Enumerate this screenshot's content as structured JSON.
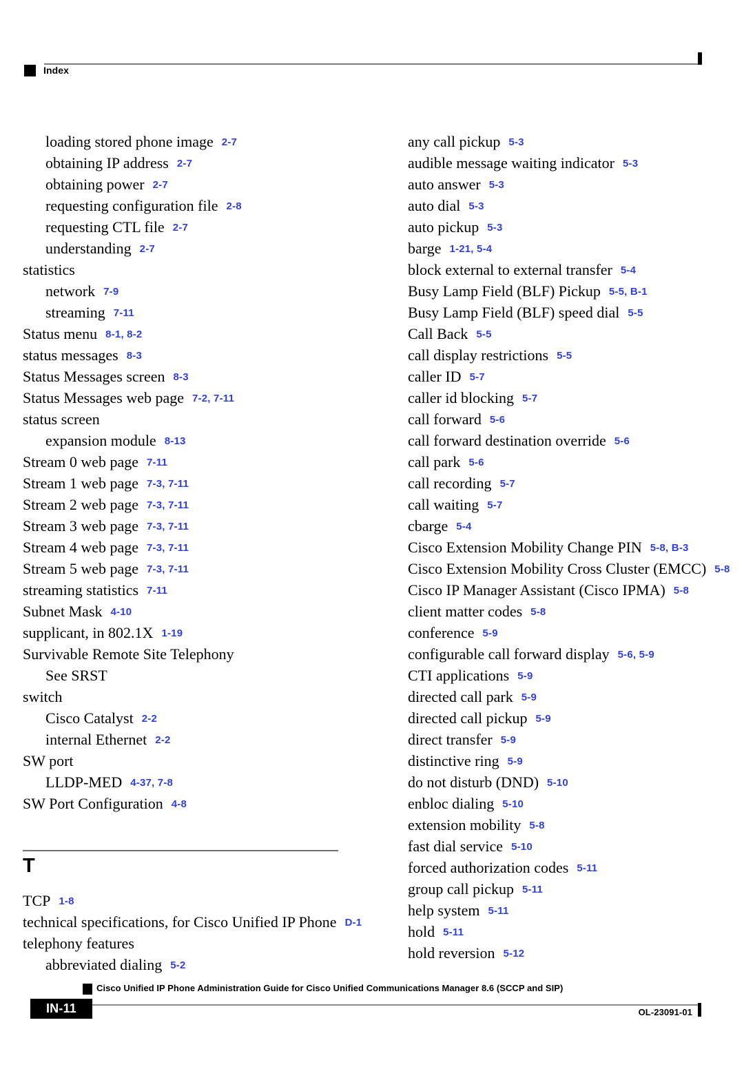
{
  "header": {
    "title": "Index",
    "marker_icon": "black-square-icon"
  },
  "columns": {
    "left": [
      {
        "kind": "entry",
        "level": 1,
        "term": "loading stored phone image",
        "refs": "2-7"
      },
      {
        "kind": "entry",
        "level": 1,
        "term": "obtaining IP address",
        "refs": "2-7"
      },
      {
        "kind": "entry",
        "level": 1,
        "term": "obtaining power",
        "refs": "2-7"
      },
      {
        "kind": "entry",
        "level": 1,
        "term": "requesting configuration file",
        "refs": "2-8"
      },
      {
        "kind": "entry",
        "level": 1,
        "term": "requesting CTL file",
        "refs": "2-7"
      },
      {
        "kind": "entry",
        "level": 1,
        "term": "understanding",
        "refs": "2-7"
      },
      {
        "kind": "entry",
        "level": 0,
        "term": "statistics",
        "refs": ""
      },
      {
        "kind": "entry",
        "level": 1,
        "term": "network",
        "refs": "7-9"
      },
      {
        "kind": "entry",
        "level": 1,
        "term": "streaming",
        "refs": "7-11"
      },
      {
        "kind": "entry",
        "level": 0,
        "term": "Status menu",
        "refs": "8-1, 8-2"
      },
      {
        "kind": "entry",
        "level": 0,
        "term": "status messages",
        "refs": "8-3"
      },
      {
        "kind": "entry",
        "level": 0,
        "term": "Status Messages screen",
        "refs": "8-3"
      },
      {
        "kind": "entry",
        "level": 0,
        "term": "Status Messages web page",
        "refs": "7-2, 7-11"
      },
      {
        "kind": "entry",
        "level": 0,
        "term": "status screen",
        "refs": ""
      },
      {
        "kind": "entry",
        "level": 1,
        "term": "expansion module",
        "refs": "8-13"
      },
      {
        "kind": "entry",
        "level": 0,
        "term": "Stream 0 web page",
        "refs": "7-11"
      },
      {
        "kind": "entry",
        "level": 0,
        "term": "Stream 1 web page",
        "refs": "7-3, 7-11"
      },
      {
        "kind": "entry",
        "level": 0,
        "term": "Stream 2 web page",
        "refs": "7-3, 7-11"
      },
      {
        "kind": "entry",
        "level": 0,
        "term": "Stream 3 web page",
        "refs": "7-3, 7-11"
      },
      {
        "kind": "entry",
        "level": 0,
        "term": "Stream 4 web page",
        "refs": "7-3, 7-11"
      },
      {
        "kind": "entry",
        "level": 0,
        "term": "Stream 5 web page",
        "refs": "7-3, 7-11"
      },
      {
        "kind": "entry",
        "level": 0,
        "term": "streaming statistics",
        "refs": "7-11"
      },
      {
        "kind": "entry",
        "level": 0,
        "term": "Subnet Mask",
        "refs": "4-10"
      },
      {
        "kind": "entry",
        "level": 0,
        "term": "supplicant, in 802.1X",
        "refs": "1-19"
      },
      {
        "kind": "entry",
        "level": 0,
        "term": "Survivable Remote Site Telephony",
        "refs": ""
      },
      {
        "kind": "entry",
        "level": 1,
        "term": "See SRST",
        "refs": ""
      },
      {
        "kind": "entry",
        "level": 0,
        "term": "switch",
        "refs": ""
      },
      {
        "kind": "entry",
        "level": 1,
        "term": "Cisco Catalyst",
        "refs": "2-2"
      },
      {
        "kind": "entry",
        "level": 1,
        "term": "internal Ethernet",
        "refs": "2-2"
      },
      {
        "kind": "entry",
        "level": 0,
        "term": "SW port",
        "refs": ""
      },
      {
        "kind": "entry",
        "level": 1,
        "term": "LLDP-MED",
        "refs": "4-37, 7-8"
      },
      {
        "kind": "entry",
        "level": 0,
        "term": "SW Port Configuration",
        "refs": "4-8"
      },
      {
        "kind": "section",
        "letter": "T"
      },
      {
        "kind": "entry",
        "level": 0,
        "term": "TCP",
        "refs": "1-8"
      },
      {
        "kind": "entry",
        "level": 0,
        "term": "technical specifications, for Cisco Unified IP Phone",
        "refs": "D-1"
      },
      {
        "kind": "entry",
        "level": 0,
        "term": "telephony features",
        "refs": ""
      },
      {
        "kind": "entry",
        "level": 1,
        "term": "abbreviated dialing",
        "refs": "5-2"
      }
    ],
    "right": [
      {
        "kind": "entry",
        "level": 0,
        "term": "any call pickup",
        "refs": "5-3"
      },
      {
        "kind": "entry",
        "level": 0,
        "term": "audible message waiting indicator",
        "refs": "5-3"
      },
      {
        "kind": "entry",
        "level": 0,
        "term": "auto answer",
        "refs": "5-3"
      },
      {
        "kind": "entry",
        "level": 0,
        "term": "auto dial",
        "refs": "5-3"
      },
      {
        "kind": "entry",
        "level": 0,
        "term": "auto pickup",
        "refs": "5-3"
      },
      {
        "kind": "entry",
        "level": 0,
        "term": "barge",
        "refs": "1-21, 5-4"
      },
      {
        "kind": "entry",
        "level": 0,
        "term": "block external to external transfer",
        "refs": "5-4"
      },
      {
        "kind": "entry",
        "level": 0,
        "term": "Busy Lamp Field (BLF) Pickup",
        "refs": "5-5, B-1"
      },
      {
        "kind": "entry",
        "level": 0,
        "term": "Busy Lamp Field (BLF) speed dial",
        "refs": "5-5"
      },
      {
        "kind": "entry",
        "level": 0,
        "term": "Call Back",
        "refs": "5-5"
      },
      {
        "kind": "entry",
        "level": 0,
        "term": "call display restrictions",
        "refs": "5-5"
      },
      {
        "kind": "entry",
        "level": 0,
        "term": "caller ID",
        "refs": "5-7"
      },
      {
        "kind": "entry",
        "level": 0,
        "term": "caller id blocking",
        "refs": "5-7"
      },
      {
        "kind": "entry",
        "level": 0,
        "term": "call forward",
        "refs": "5-6"
      },
      {
        "kind": "entry",
        "level": 0,
        "term": "call forward destination override",
        "refs": "5-6"
      },
      {
        "kind": "entry",
        "level": 0,
        "term": "call park",
        "refs": "5-6"
      },
      {
        "kind": "entry",
        "level": 0,
        "term": "call recording",
        "refs": "5-7"
      },
      {
        "kind": "entry",
        "level": 0,
        "term": "call waiting",
        "refs": "5-7"
      },
      {
        "kind": "entry",
        "level": 0,
        "term": "cbarge",
        "refs": "5-4"
      },
      {
        "kind": "entry",
        "level": 0,
        "term": "Cisco Extension Mobility Change PIN",
        "refs": "5-8, B-3"
      },
      {
        "kind": "entry",
        "level": 0,
        "term": "Cisco Extension Mobility Cross Cluster (EMCC)",
        "refs": "5-8"
      },
      {
        "kind": "entry",
        "level": 0,
        "term": "Cisco IP Manager Assistant (Cisco IPMA)",
        "refs": "5-8"
      },
      {
        "kind": "entry",
        "level": 0,
        "term": "client matter codes",
        "refs": "5-8"
      },
      {
        "kind": "entry",
        "level": 0,
        "term": "conference",
        "refs": "5-9"
      },
      {
        "kind": "entry",
        "level": 0,
        "term": "configurable call forward display",
        "refs": "5-6, 5-9"
      },
      {
        "kind": "entry",
        "level": 0,
        "term": "CTI applications",
        "refs": "5-9"
      },
      {
        "kind": "entry",
        "level": 0,
        "term": "directed call park",
        "refs": "5-9"
      },
      {
        "kind": "entry",
        "level": 0,
        "term": "directed call pickup",
        "refs": "5-9"
      },
      {
        "kind": "entry",
        "level": 0,
        "term": "direct transfer",
        "refs": "5-9"
      },
      {
        "kind": "entry",
        "level": 0,
        "term": "distinctive ring",
        "refs": "5-9"
      },
      {
        "kind": "entry",
        "level": 0,
        "term": "do not disturb (DND)",
        "refs": "5-10"
      },
      {
        "kind": "entry",
        "level": 0,
        "term": "enbloc dialing",
        "refs": "5-10"
      },
      {
        "kind": "entry",
        "level": 0,
        "term": "extension mobility",
        "refs": "5-8"
      },
      {
        "kind": "entry",
        "level": 0,
        "term": "fast dial service",
        "refs": "5-10"
      },
      {
        "kind": "entry",
        "level": 0,
        "term": "forced authorization codes",
        "refs": "5-11"
      },
      {
        "kind": "entry",
        "level": 0,
        "term": "group call pickup",
        "refs": "5-11"
      },
      {
        "kind": "entry",
        "level": 0,
        "term": "help system",
        "refs": "5-11"
      },
      {
        "kind": "entry",
        "level": 0,
        "term": "hold",
        "refs": "5-11"
      },
      {
        "kind": "entry",
        "level": 0,
        "term": "hold reversion",
        "refs": "5-12"
      }
    ]
  },
  "footer": {
    "book_title": "Cisco Unified IP Phone Administration Guide for Cisco Unified Communications Manager 8.6 (SCCP and SIP)",
    "page_number": "IN-11",
    "document_id": "OL-23091-01",
    "marker_icon": "black-square-icon"
  },
  "colors": {
    "reference_blue": "#2f3fe0",
    "rule_gray": "#7d7d7d",
    "text_black": "#000000"
  }
}
